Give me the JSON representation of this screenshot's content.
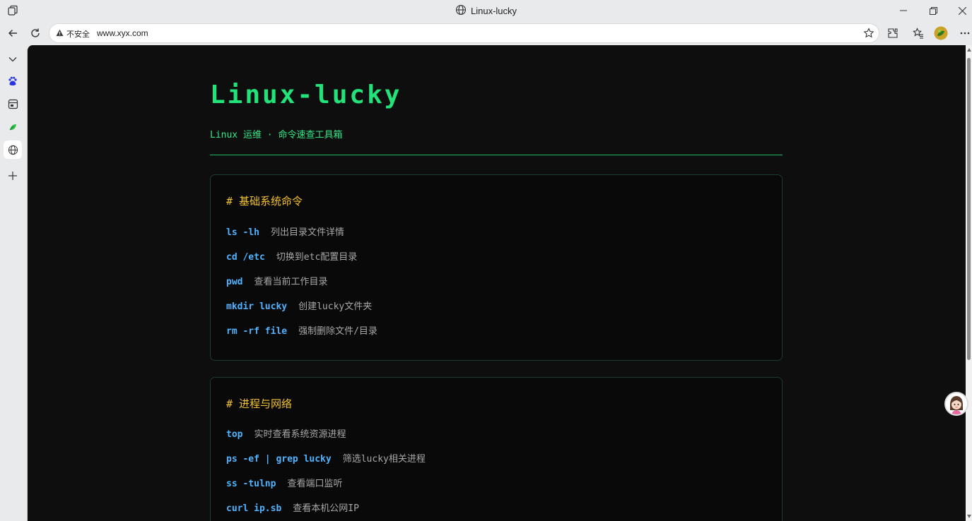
{
  "browser": {
    "window_title": "Linux-lucky",
    "security_label": "不安全",
    "url": "www.xyx.com"
  },
  "page": {
    "title": "Linux-lucky",
    "subtitle": "Linux 运维 · 命令速查工具箱",
    "sections": [
      {
        "heading": "# 基础系统命令",
        "commands": [
          {
            "cmd": "ls -lh",
            "desc": "列出目录文件详情"
          },
          {
            "cmd": "cd /etc",
            "desc": "切换到etc配置目录"
          },
          {
            "cmd": "pwd",
            "desc": "查看当前工作目录"
          },
          {
            "cmd": "mkdir lucky",
            "desc": "创建lucky文件夹"
          },
          {
            "cmd": "rm -rf file",
            "desc": "强制删除文件/目录"
          }
        ]
      },
      {
        "heading": "# 进程与网络",
        "commands": [
          {
            "cmd": "top",
            "desc": "实时查看系统资源进程"
          },
          {
            "cmd": "ps -ef | grep lucky",
            "desc": "筛选lucky相关进程"
          },
          {
            "cmd": "ss -tulnp",
            "desc": "查看端口监听"
          },
          {
            "cmd": "curl ip.sb",
            "desc": "查看本机公网IP"
          }
        ]
      }
    ]
  },
  "colors": {
    "title_green": "#22e27a",
    "heading_yellow": "#f2c230",
    "command_blue": "#4fb3ff",
    "desc_gray": "#a8a8a8",
    "background": "#0e0e0e"
  }
}
